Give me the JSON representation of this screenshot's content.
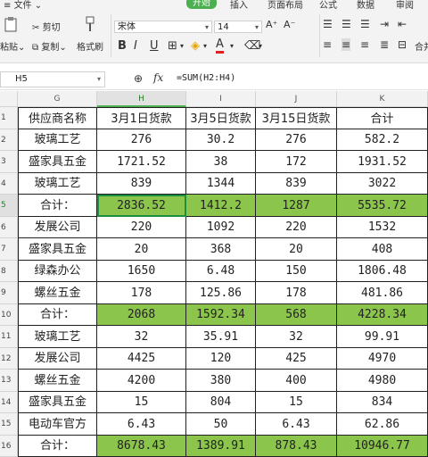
{
  "menu": {
    "file": "文件",
    "tabs": [
      "开始",
      "插入",
      "页面布局",
      "公式",
      "数据",
      "审阅"
    ],
    "active_tab": "开始"
  },
  "ribbon": {
    "paste": "粘贴",
    "cut": "剪切",
    "copy": "复制",
    "format_painter": "格式刷",
    "font_name": "宋体",
    "font_size": "14",
    "merge": "合并",
    "accent_color": "#4caf50"
  },
  "formula_bar": {
    "name_box": "H5",
    "fx": "fx",
    "formula": "=SUM(H2:H4)"
  },
  "columns": [
    "G",
    "H",
    "I",
    "J",
    "K"
  ],
  "selected_column": "H",
  "rows": [
    {
      "num": "1",
      "cells": [
        "供应商名称",
        "3月1日货款",
        "3月5日货款",
        "3月15日货款",
        "合计"
      ],
      "green": false
    },
    {
      "num": "2",
      "cells": [
        "玻璃工艺",
        "276",
        "30.2",
        "276",
        "582.2"
      ],
      "green": false
    },
    {
      "num": "3",
      "cells": [
        "盛家具五金",
        "1721.52",
        "38",
        "172",
        "1931.52"
      ],
      "green": false
    },
    {
      "num": "4",
      "cells": [
        "玻璃工艺",
        "839",
        "1344",
        "839",
        "3022"
      ],
      "green": false
    },
    {
      "num": "5",
      "cells": [
        "合计：",
        "2836.52",
        "1412.2",
        "1287",
        "5535.72"
      ],
      "green": true
    },
    {
      "num": "6",
      "cells": [
        "发展公司",
        "220",
        "1092",
        "220",
        "1532"
      ],
      "green": false
    },
    {
      "num": "7",
      "cells": [
        "盛家具五金",
        "20",
        "368",
        "20",
        "408"
      ],
      "green": false
    },
    {
      "num": "8",
      "cells": [
        "绿森办公",
        "1650",
        "6.48",
        "150",
        "1806.48"
      ],
      "green": false
    },
    {
      "num": "9",
      "cells": [
        "螺丝五金",
        "178",
        "125.86",
        "178",
        "481.86"
      ],
      "green": false
    },
    {
      "num": "10",
      "cells": [
        "合计：",
        "2068",
        "1592.34",
        "568",
        "4228.34"
      ],
      "green": true
    },
    {
      "num": "11",
      "cells": [
        "玻璃工艺",
        "32",
        "35.91",
        "32",
        "99.91"
      ],
      "green": false
    },
    {
      "num": "12",
      "cells": [
        "发展公司",
        "4425",
        "120",
        "425",
        "4970"
      ],
      "green": false
    },
    {
      "num": "13",
      "cells": [
        "螺丝五金",
        "4200",
        "380",
        "400",
        "4980"
      ],
      "green": false
    },
    {
      "num": "14",
      "cells": [
        "盛家具五金",
        "15",
        "804",
        "15",
        "834"
      ],
      "green": false
    },
    {
      "num": "15",
      "cells": [
        "电动车官方",
        "6.43",
        "50",
        "6.43",
        "62.86"
      ],
      "green": false
    },
    {
      "num": "16",
      "cells": [
        "合计：",
        "8678.43",
        "1389.91",
        "878.43",
        "10946.77"
      ],
      "green": true
    }
  ],
  "active_cell": {
    "row": "5",
    "col": "H"
  }
}
